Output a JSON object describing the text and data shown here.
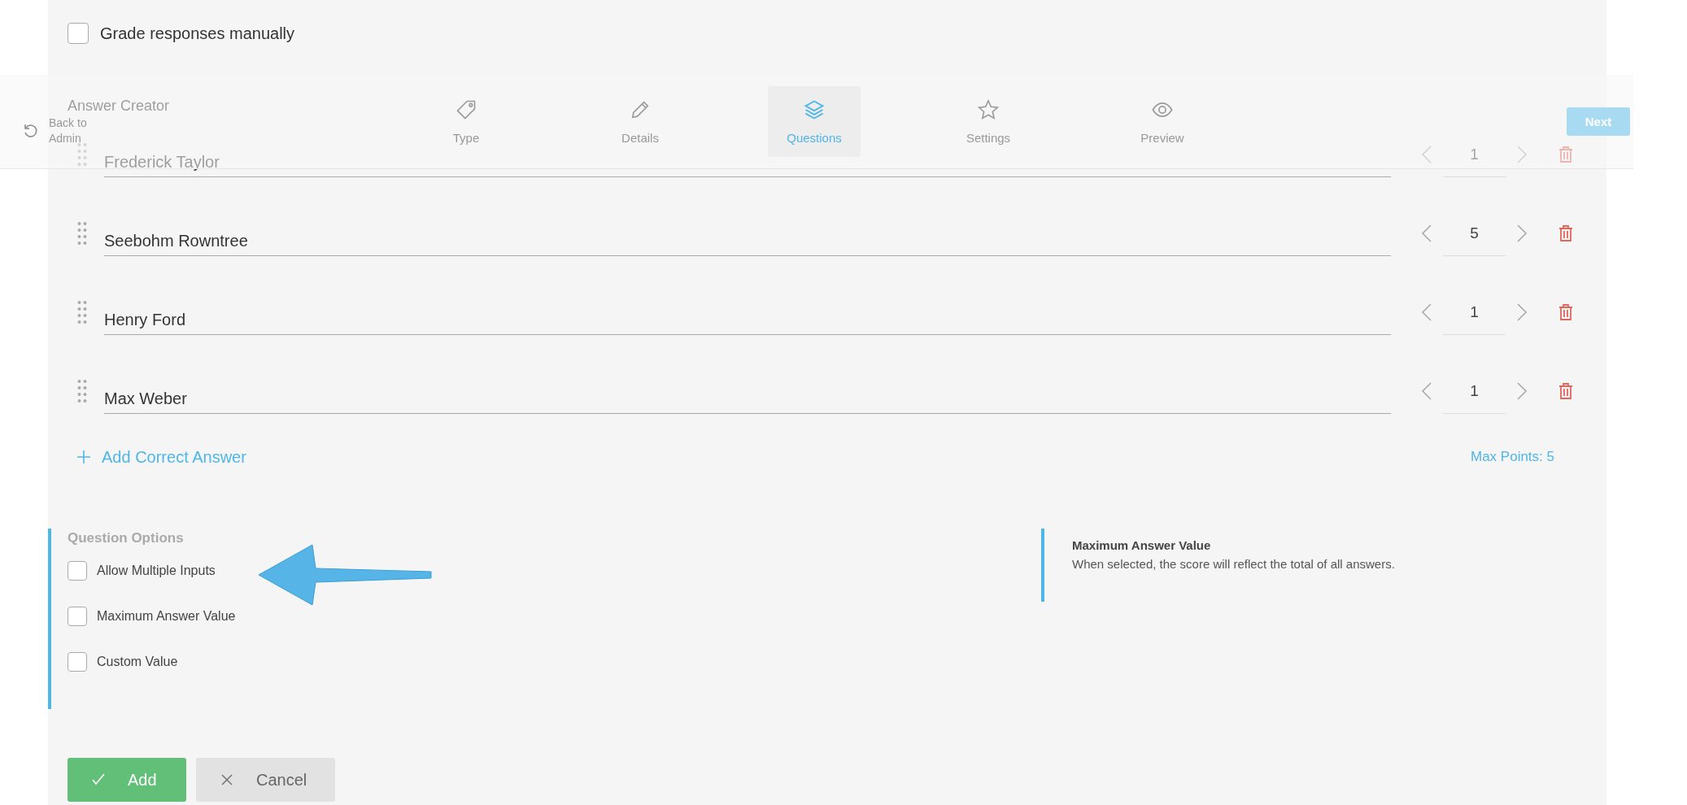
{
  "grading": {
    "label": "Grade responses manually",
    "checked": false
  },
  "nav": {
    "back": "Back to Admin",
    "tabs": [
      {
        "kind": "tag",
        "label": "Type",
        "selected": false
      },
      {
        "kind": "pencil",
        "label": "Details",
        "selected": false
      },
      {
        "kind": "layers",
        "label": "Questions",
        "selected": true
      },
      {
        "kind": "star",
        "label": "Settings",
        "selected": false
      },
      {
        "kind": "eye",
        "label": "Preview",
        "selected": false
      }
    ],
    "next": "Next"
  },
  "answer_creator": {
    "title": "Answer Creator",
    "answers": [
      {
        "text": "Frederick Taylor",
        "points": "1"
      },
      {
        "text": "Seebohm Rowntree",
        "points": "5"
      },
      {
        "text": "Henry Ford",
        "points": "1"
      },
      {
        "text": "Max Weber",
        "points": "1"
      }
    ],
    "add_label": "Add Correct Answer",
    "max_points": "Max Points: 5"
  },
  "question_options": {
    "title": "Question Options",
    "options": [
      {
        "label": "Allow Multiple Inputs",
        "checked": false
      },
      {
        "label": "Maximum Answer Value",
        "checked": false
      },
      {
        "label": "Custom Value",
        "checked": false
      }
    ]
  },
  "info": {
    "title": "Maximum Answer Value",
    "description": "When selected, the score will reflect the total of all answers."
  },
  "buttons": [
    {
      "kind": "confirm",
      "label": "Add"
    },
    {
      "kind": "cancel",
      "label": "Cancel"
    }
  ]
}
